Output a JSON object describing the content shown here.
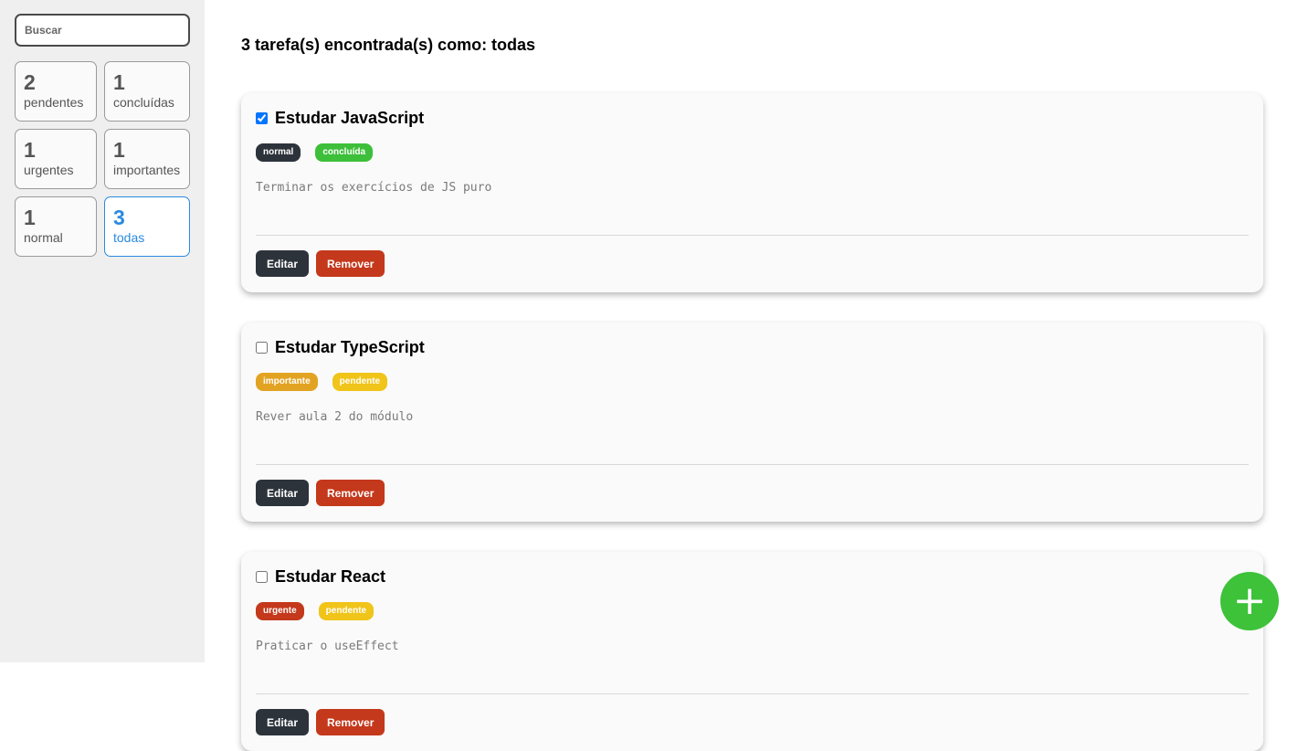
{
  "sidebar": {
    "search_placeholder": "Buscar",
    "filters": [
      {
        "count": "2",
        "label": "pendentes"
      },
      {
        "count": "1",
        "label": "concluídas"
      },
      {
        "count": "1",
        "label": "urgentes"
      },
      {
        "count": "1",
        "label": "importantes"
      },
      {
        "count": "1",
        "label": "normal"
      },
      {
        "count": "3",
        "label": "todas",
        "active": true
      }
    ]
  },
  "main": {
    "summary": "3 tarefa(s) encontrada(s) como: todas",
    "tasks": [
      {
        "title": "Estudar JavaScript",
        "checked": true,
        "tags": [
          {
            "label": "normal",
            "color": "#2d333b"
          },
          {
            "label": "concluída",
            "color": "#3dbf3a"
          }
        ],
        "description": "Terminar os exercícios de JS puro",
        "edit_label": "Editar",
        "remove_label": "Remover"
      },
      {
        "title": "Estudar TypeScript",
        "checked": false,
        "tags": [
          {
            "label": "importante",
            "color": "#e3a322"
          },
          {
            "label": "pendente",
            "color": "#f0c419"
          }
        ],
        "description": "Rever aula 2 do módulo",
        "edit_label": "Editar",
        "remove_label": "Remover"
      },
      {
        "title": "Estudar React",
        "checked": false,
        "tags": [
          {
            "label": "urgente",
            "color": "#c4381c"
          },
          {
            "label": "pendente",
            "color": "#f0c419"
          }
        ],
        "description": "Praticar o useEffect",
        "edit_label": "Editar",
        "remove_label": "Remover"
      }
    ]
  },
  "fab": {
    "label": "+",
    "color": "#3dc23a"
  }
}
